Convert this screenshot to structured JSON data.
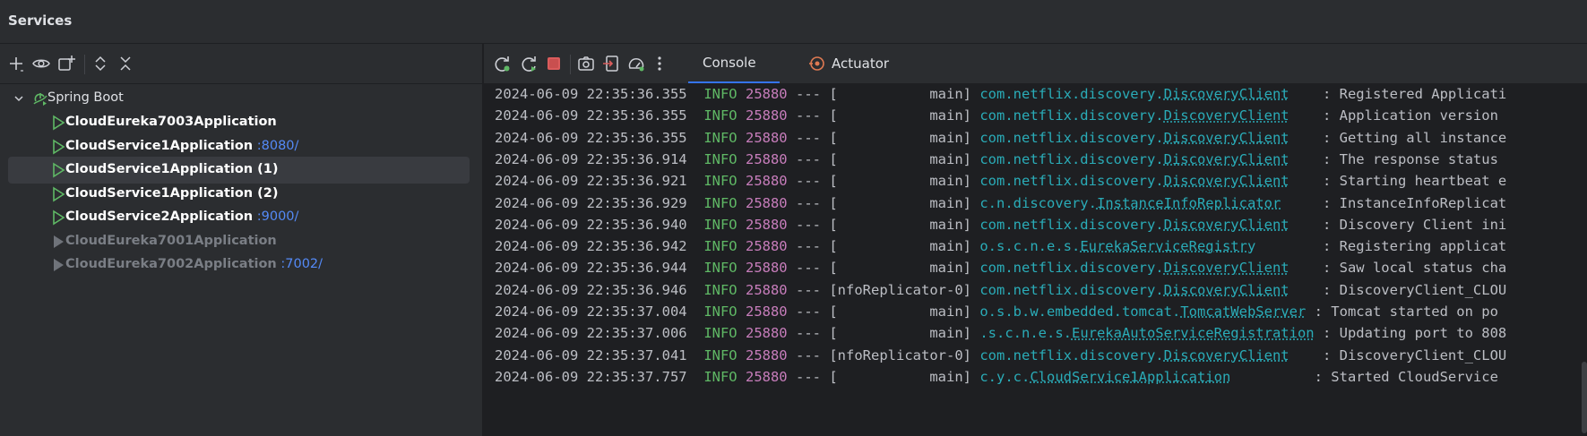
{
  "window": {
    "title": "Services"
  },
  "left_toolbar": {
    "buttons": [
      "add-icon",
      "eye-icon",
      "new-group-icon",
      "expand-all-icon",
      "collapse-all-icon"
    ]
  },
  "right_toolbar": {
    "buttons": [
      "rerun-icon",
      "restart-icon",
      "stop-icon",
      "screenshot-icon",
      "attach-icon",
      "profiler-icon",
      "more-icon"
    ],
    "tabs": [
      {
        "label": "Console",
        "active": true
      },
      {
        "label": "Actuator",
        "active": false
      }
    ]
  },
  "tree": {
    "root": {
      "label": "Spring Boot",
      "expanded": true
    },
    "items": [
      {
        "name": "CloudEureka7003Application",
        "port": "",
        "running": true,
        "selected": false
      },
      {
        "name": "CloudService1Application",
        "port": ":8080/",
        "running": true,
        "selected": false
      },
      {
        "name": "CloudService1Application (1)",
        "port": "",
        "running": true,
        "selected": true
      },
      {
        "name": "CloudService1Application (2)",
        "port": "",
        "running": true,
        "selected": false
      },
      {
        "name": "CloudService2Application",
        "port": ":9000/",
        "running": true,
        "selected": false
      },
      {
        "name": "CloudEureka7001Application",
        "port": "",
        "running": false,
        "selected": false
      },
      {
        "name": "CloudEureka7002Application",
        "port": ":7002/",
        "running": false,
        "selected": false
      }
    ]
  },
  "console": {
    "lines": [
      {
        "ts": "2024-06-09 22:35:36.355",
        "level": "INFO",
        "pid": "25880",
        "sep": "---",
        "thread": "[           main]",
        "pkg": "com.netflix.discovery.",
        "cls": "DiscoveryClient",
        "pad": "    ",
        "msg": ": Registered Applicati"
      },
      {
        "ts": "2024-06-09 22:35:36.355",
        "level": "INFO",
        "pid": "25880",
        "sep": "---",
        "thread": "[           main]",
        "pkg": "com.netflix.discovery.",
        "cls": "DiscoveryClient",
        "pad": "    ",
        "msg": ": Application version"
      },
      {
        "ts": "2024-06-09 22:35:36.355",
        "level": "INFO",
        "pid": "25880",
        "sep": "---",
        "thread": "[           main]",
        "pkg": "com.netflix.discovery.",
        "cls": "DiscoveryClient",
        "pad": "    ",
        "msg": ": Getting all instance"
      },
      {
        "ts": "2024-06-09 22:35:36.914",
        "level": "INFO",
        "pid": "25880",
        "sep": "---",
        "thread": "[           main]",
        "pkg": "com.netflix.discovery.",
        "cls": "DiscoveryClient",
        "pad": "    ",
        "msg": ": The response status"
      },
      {
        "ts": "2024-06-09 22:35:36.921",
        "level": "INFO",
        "pid": "25880",
        "sep": "---",
        "thread": "[           main]",
        "pkg": "com.netflix.discovery.",
        "cls": "DiscoveryClient",
        "pad": "    ",
        "msg": ": Starting heartbeat e"
      },
      {
        "ts": "2024-06-09 22:35:36.929",
        "level": "INFO",
        "pid": "25880",
        "sep": "---",
        "thread": "[           main]",
        "pkg": "c.n.discovery.",
        "cls": "InstanceInfoReplicator",
        "pad": "     ",
        "msg": ": InstanceInfoReplicat"
      },
      {
        "ts": "2024-06-09 22:35:36.940",
        "level": "INFO",
        "pid": "25880",
        "sep": "---",
        "thread": "[           main]",
        "pkg": "com.netflix.discovery.",
        "cls": "DiscoveryClient",
        "pad": "    ",
        "msg": ": Discovery Client ini"
      },
      {
        "ts": "2024-06-09 22:35:36.942",
        "level": "INFO",
        "pid": "25880",
        "sep": "---",
        "thread": "[           main]",
        "pkg": "o.s.c.n.e.s.",
        "cls": "EurekaServiceRegistry",
        "pad": "        ",
        "msg": ": Registering applicat"
      },
      {
        "ts": "2024-06-09 22:35:36.944",
        "level": "INFO",
        "pid": "25880",
        "sep": "---",
        "thread": "[           main]",
        "pkg": "com.netflix.discovery.",
        "cls": "DiscoveryClient",
        "pad": "    ",
        "msg": ": Saw local status cha"
      },
      {
        "ts": "2024-06-09 22:35:36.946",
        "level": "INFO",
        "pid": "25880",
        "sep": "---",
        "thread": "[nfoReplicator-0]",
        "pkg": "com.netflix.discovery.",
        "cls": "DiscoveryClient",
        "pad": "    ",
        "msg": ": DiscoveryClient_CLOU"
      },
      {
        "ts": "2024-06-09 22:35:37.004",
        "level": "INFO",
        "pid": "25880",
        "sep": "---",
        "thread": "[           main]",
        "pkg": "o.s.b.w.embedded.tomcat.",
        "cls": "TomcatWebServer",
        "pad": " ",
        "msg": ": Tomcat started on po"
      },
      {
        "ts": "2024-06-09 22:35:37.006",
        "level": "INFO",
        "pid": "25880",
        "sep": "---",
        "thread": "[           main]",
        "pkg": ".s.c.n.e.s.",
        "cls": "EurekaAutoServiceRegistration",
        "pad": " ",
        "msg": ": Updating port to 808"
      },
      {
        "ts": "2024-06-09 22:35:37.041",
        "level": "INFO",
        "pid": "25880",
        "sep": "---",
        "thread": "[nfoReplicator-0]",
        "pkg": "com.netflix.discovery.",
        "cls": "DiscoveryClient",
        "pad": "    ",
        "msg": ": DiscoveryClient_CLOU"
      },
      {
        "ts": "2024-06-09 22:35:37.757",
        "level": "INFO",
        "pid": "25880",
        "sep": "---",
        "thread": "[           main]",
        "pkg": "c.y.c.",
        "cls": "CloudService1Application",
        "pad": "          ",
        "msg": ": Started CloudService"
      }
    ]
  },
  "colors": {
    "accent": "#3574f0",
    "run_green": "#5fb865",
    "stop_red": "#db5c5c",
    "port_blue": "#548af7",
    "logger_cyan": "#2aacb8",
    "pid_magenta": "#c77dbb"
  }
}
